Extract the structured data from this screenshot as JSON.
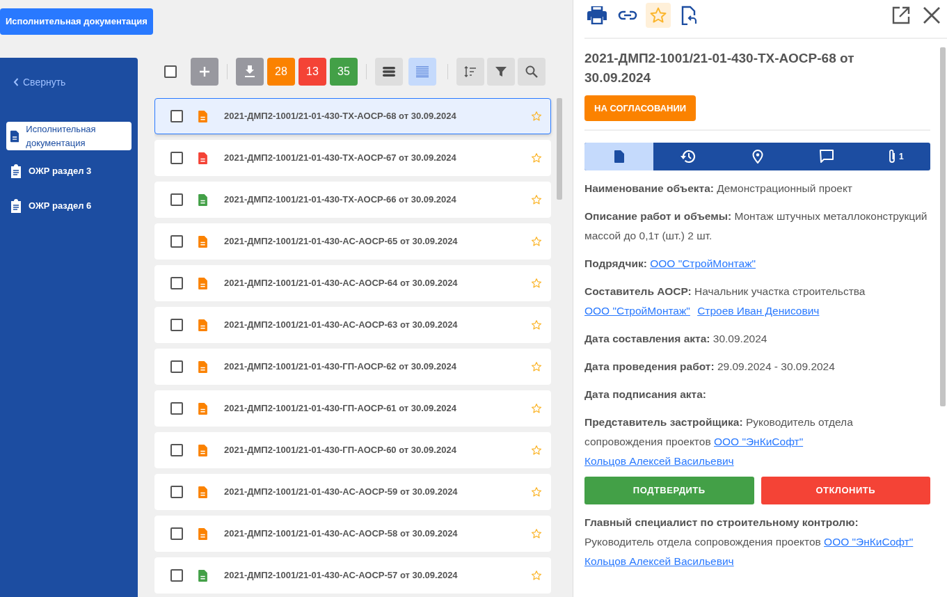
{
  "top_button": "Исполнительная документация",
  "sidebar": {
    "collapse": "Свернуть",
    "items": [
      {
        "label": "Исполнительная документация",
        "kind": "doc",
        "selected": true
      },
      {
        "label": "ОЖР раздел 3",
        "kind": "clipboard",
        "selected": false
      },
      {
        "label": "ОЖР раздел 6",
        "kind": "clipboard",
        "selected": false
      }
    ]
  },
  "toolbar": {
    "select_all_checked": false,
    "counters": [
      {
        "count": "28",
        "color": "#fb8200"
      },
      {
        "count": "13",
        "color": "#f44336"
      },
      {
        "count": "35",
        "color": "#43a047"
      }
    ],
    "views": [
      {
        "kind": "rows",
        "selected": false
      },
      {
        "kind": "lines",
        "selected": true
      }
    ]
  },
  "documents": [
    {
      "title": "2021-ДМП2-1001/21-01-430-ТХ-АОСР-68 от 30.09.2024",
      "color": "#fb8200",
      "selected": true,
      "checked": false
    },
    {
      "title": "2021-ДМП2-1001/21-01-430-ТХ-АОСР-67 от 30.09.2024",
      "color": "#f44336",
      "selected": false,
      "checked": false
    },
    {
      "title": "2021-ДМП2-1001/21-01-430-ТХ-АОСР-66 от 30.09.2024",
      "color": "#43a047",
      "selected": false,
      "checked": false
    },
    {
      "title": "2021-ДМП2-1001/21-01-430-АС-АОСР-65 от 30.09.2024",
      "color": "#fb8200",
      "selected": false,
      "checked": false
    },
    {
      "title": "2021-ДМП2-1001/21-01-430-АС-АОСР-64 от 30.09.2024",
      "color": "#fb8200",
      "selected": false,
      "checked": false
    },
    {
      "title": "2021-ДМП2-1001/21-01-430-АС-АОСР-63 от 30.09.2024",
      "color": "#fb8200",
      "selected": false,
      "checked": false
    },
    {
      "title": "2021-ДМП2-1001/21-01-430-ГП-АОСР-62 от 30.09.2024",
      "color": "#fb8200",
      "selected": false,
      "checked": false
    },
    {
      "title": "2021-ДМП2-1001/21-01-430-ГП-АОСР-61 от 30.09.2024",
      "color": "#fb8200",
      "selected": false,
      "checked": false
    },
    {
      "title": "2021-ДМП2-1001/21-01-430-ГП-АОСР-60 от 30.09.2024",
      "color": "#fb8200",
      "selected": false,
      "checked": false
    },
    {
      "title": "2021-ДМП2-1001/21-01-430-АС-АОСР-59 от 30.09.2024",
      "color": "#fb8200",
      "selected": false,
      "checked": false
    },
    {
      "title": "2021-ДМП2-1001/21-01-430-АС-АОСР-58 от 30.09.2024",
      "color": "#fb8200",
      "selected": false,
      "checked": false
    },
    {
      "title": "2021-ДМП2-1001/21-01-430-АС-АОСР-57 от 30.09.2024",
      "color": "#43a047",
      "selected": false,
      "checked": false
    }
  ],
  "detail": {
    "favorite_selected": true,
    "title": "2021-ДМП2-1001/21-01-430-ТХ-АОСР-68 от 30.09.2024",
    "status": "НА СОГЛАСОВАНИИ",
    "tabs": [
      {
        "kind": "document",
        "selected": true
      },
      {
        "kind": "history",
        "selected": false
      },
      {
        "kind": "location",
        "selected": false
      },
      {
        "kind": "comments",
        "selected": false
      },
      {
        "kind": "attachments",
        "selected": false,
        "count": "1"
      }
    ],
    "items": [
      {
        "kind": "field",
        "label": "Наименование объекта:",
        "parts": [
          {
            "kind": "text",
            "text": "Демонстрационный проект"
          }
        ]
      },
      {
        "kind": "field",
        "label": "Описание работ и объемы:",
        "parts": [
          {
            "kind": "text",
            "text": "Монтаж штучных металлоконструкций массой до 0,1т (шт.) 2 шт."
          }
        ]
      },
      {
        "kind": "field",
        "label": "Подрядчик:",
        "parts": [
          {
            "kind": "link",
            "text": "ООО \"СтройМонтаж\""
          }
        ]
      },
      {
        "kind": "field",
        "label": "Составитель АОСР:",
        "parts": [
          {
            "kind": "text",
            "text": "Начальник участка строительства"
          },
          {
            "kind": "link",
            "text": "ООО \"СтройМонтаж\""
          },
          {
            "kind": "link",
            "text": "Строев Иван Денисович"
          }
        ]
      },
      {
        "kind": "field",
        "label": "Дата составления акта:",
        "parts": [
          {
            "kind": "text",
            "text": "30.09.2024"
          }
        ]
      },
      {
        "kind": "field",
        "label": "Дата проведения работ:",
        "parts": [
          {
            "kind": "text",
            "text": "29.09.2024 - 30.09.2024"
          }
        ]
      },
      {
        "kind": "field",
        "label": "Дата подписания акта:"
      },
      {
        "kind": "field",
        "label": "Представитель застройщика:",
        "parts": [
          {
            "kind": "text",
            "text": "Руководитель отдела сопровождения проектов"
          },
          {
            "kind": "link",
            "text": "ООО \"ЭнКиСофт\""
          },
          {
            "kind": "link",
            "text": "Кольцов Алексей Васильевич"
          }
        ]
      },
      {
        "kind": "actions",
        "approve": "ПОДТВЕРДИТЬ",
        "reject": "ОТКЛОНИТЬ"
      },
      {
        "kind": "field",
        "label": "Главный специалист по строительному контролю:",
        "parts": [
          {
            "kind": "text",
            "text": "Руководитель отдела сопровождения проектов"
          },
          {
            "kind": "link",
            "text": "ООО \"ЭнКиСофт\""
          },
          {
            "kind": "link",
            "text": "Кольцов Алексей Васильевич"
          }
        ]
      }
    ]
  }
}
